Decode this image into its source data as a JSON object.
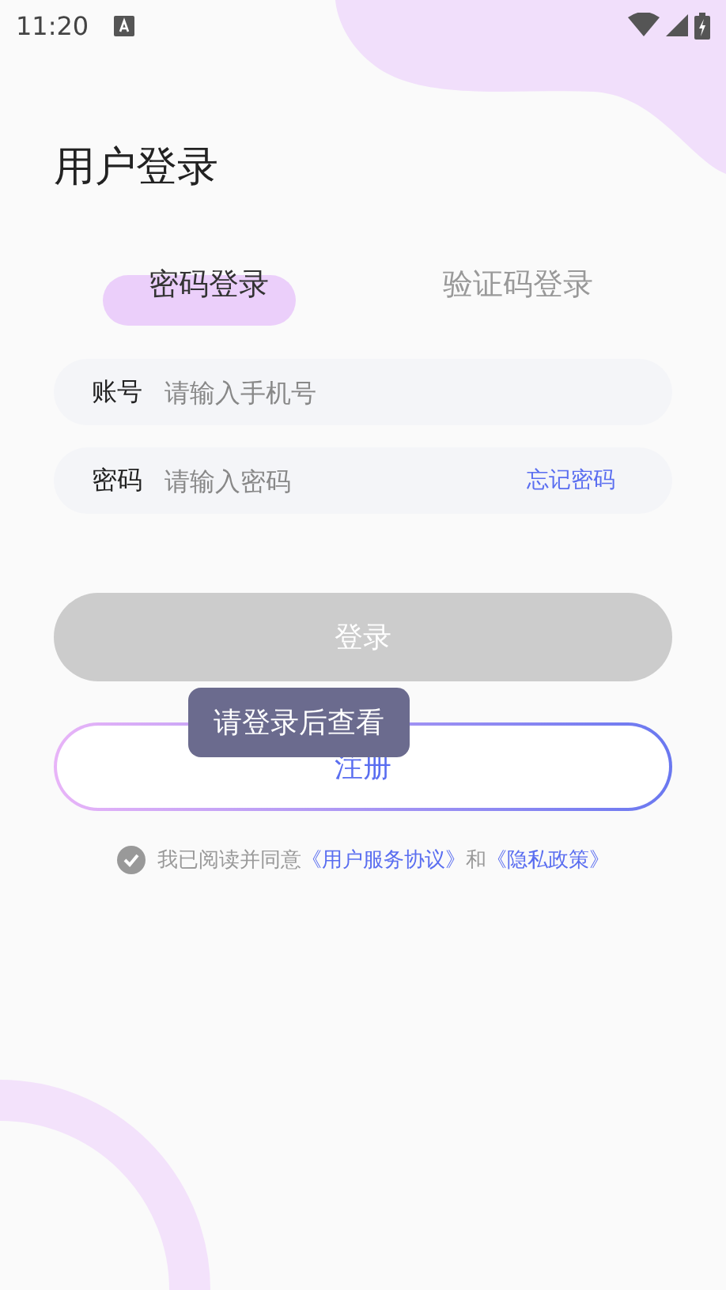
{
  "status_bar": {
    "time": "11:20"
  },
  "title": "用户登录",
  "tabs": [
    {
      "label": "密码登录",
      "selected": true
    },
    {
      "label": "验证码登录",
      "selected": false
    }
  ],
  "fields": [
    {
      "label": "账号",
      "placeholder": "请输入手机号"
    },
    {
      "label": "密码",
      "placeholder": "请输入密码",
      "link": "忘记密码"
    }
  ],
  "login_button": {
    "label": "登录",
    "disabled": true
  },
  "toast": "请登录后查看",
  "register_button": {
    "label": "注册"
  },
  "agreement": {
    "checked": false,
    "text": "我已阅读并同意",
    "link_1": "《用户服务协议》",
    "conjunction": "和",
    "link_2": "《隐私政策》"
  }
}
